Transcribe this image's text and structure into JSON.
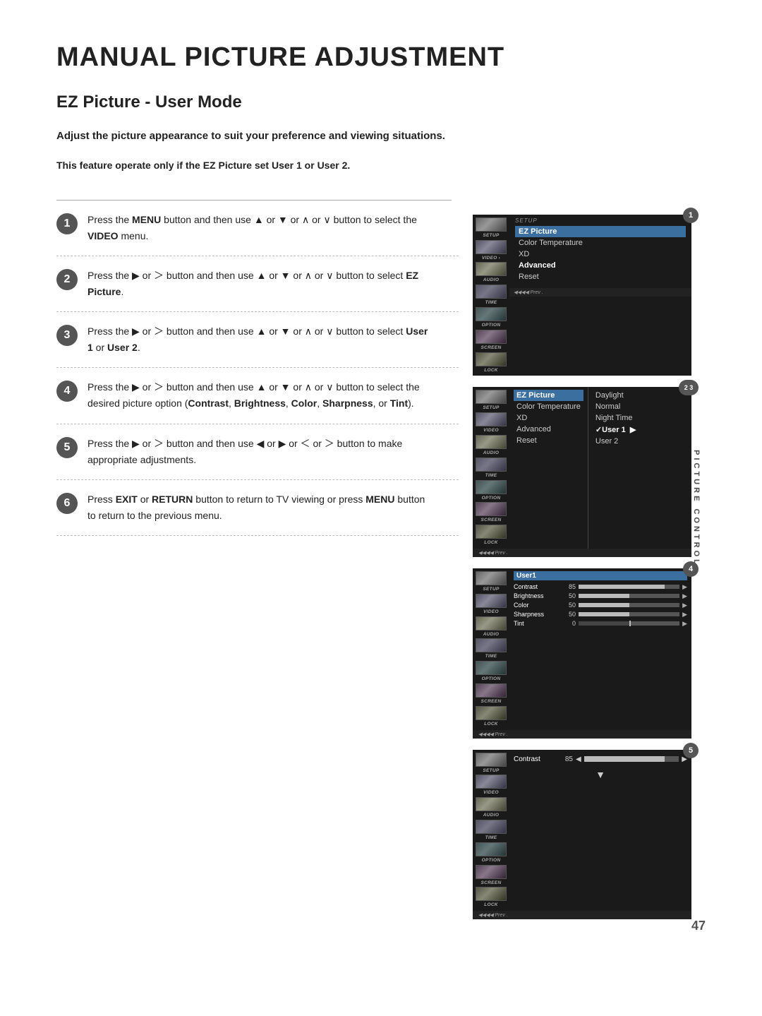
{
  "page": {
    "main_title": "MANUAL PICTURE ADJUSTMENT",
    "subtitle": "EZ Picture - User Mode",
    "intro": "Adjust the picture appearance to suit your preference and viewing situations.",
    "feature_note": "This feature operate only if the EZ Picture set User 1 or User 2.",
    "page_number": "47",
    "vertical_label": "PICTURE CONTROL"
  },
  "steps": [
    {
      "num": "1",
      "text_parts": [
        {
          "t": "Press the ",
          "b": false
        },
        {
          "t": "MENU",
          "b": true
        },
        {
          "t": " button and then use ▲ or ▼  or ∧ or ∨  button to select the ",
          "b": false
        },
        {
          "t": "VIDEO",
          "b": true
        },
        {
          "t": " menu.",
          "b": false
        }
      ]
    },
    {
      "num": "2",
      "text_parts": [
        {
          "t": "Press the ▶ or ＞ button and then use ▲ or ▼  or ∧ or ∨  button to select ",
          "b": false
        },
        {
          "t": "EZ Picture",
          "b": true
        },
        {
          "t": ".",
          "b": false
        }
      ]
    },
    {
      "num": "3",
      "text_parts": [
        {
          "t": "Press the ▶ or ＞ button and then use ▲ or ▼  or ∧ or ∨  button to select ",
          "b": false
        },
        {
          "t": "User 1",
          "b": true
        },
        {
          "t": " or ",
          "b": false
        },
        {
          "t": "User 2",
          "b": true
        },
        {
          "t": ".",
          "b": false
        }
      ]
    },
    {
      "num": "4",
      "text_parts": [
        {
          "t": "Press the ▶ or ＞ button and then use ▲ or ▼  or ∧ or ∨  button to select the desired picture option (",
          "b": false
        },
        {
          "t": "Contrast",
          "b": true
        },
        {
          "t": ", ",
          "b": false
        },
        {
          "t": "Brightness",
          "b": true
        },
        {
          "t": ", ",
          "b": false
        },
        {
          "t": "Color",
          "b": true
        },
        {
          "t": ", ",
          "b": false
        },
        {
          "t": "Sharpness",
          "b": true
        },
        {
          "t": ", or ",
          "b": false
        },
        {
          "t": "Tint",
          "b": true
        },
        {
          "t": ").",
          "b": false
        }
      ]
    },
    {
      "num": "5",
      "text_parts": [
        {
          "t": "Press the ▶ or ＞ button and then use ◀ or ▶ or ＜ or ＞ button to make appropriate adjustments.",
          "b": false
        }
      ]
    },
    {
      "num": "6",
      "text_parts": [
        {
          "t": "Press ",
          "b": false
        },
        {
          "t": "EXIT",
          "b": true
        },
        {
          "t": " or ",
          "b": false
        },
        {
          "t": "RETURN",
          "b": true
        },
        {
          "t": " button to return to TV viewing or press ",
          "b": false
        },
        {
          "t": "MENU",
          "b": true
        },
        {
          "t": " button to return to the previous menu.",
          "b": false
        }
      ]
    }
  ],
  "screenshots": [
    {
      "badge": "1",
      "sidebar_items": [
        "SETUP",
        "VIDEO",
        "AUDIO",
        "TIME",
        "OPTION",
        "SCREEN",
        "LOCK"
      ],
      "menu_title": "SETUP",
      "menu_items": [
        {
          "label": "EZ Picture",
          "selected": true
        },
        {
          "label": "Color Temperature",
          "selected": false
        },
        {
          "label": "XD",
          "selected": false
        },
        {
          "label": "Advanced",
          "selected": false
        },
        {
          "label": "Reset",
          "selected": false
        }
      ],
      "sub_items": []
    },
    {
      "badge": "2 3",
      "sidebar_items": [
        "SETUP",
        "VIDEO",
        "AUDIO",
        "TIME",
        "OPTION",
        "SCREEN",
        "LOCK"
      ],
      "menu_title": "",
      "menu_items": [
        {
          "label": "EZ Picture",
          "selected": true
        },
        {
          "label": "Color Temperature",
          "selected": false
        },
        {
          "label": "XD",
          "selected": false
        },
        {
          "label": "Advanced",
          "selected": false
        },
        {
          "label": "Reset",
          "selected": false
        }
      ],
      "sub_items": [
        {
          "label": "Daylight",
          "selected": false
        },
        {
          "label": "Normal",
          "selected": false
        },
        {
          "label": "Night Time",
          "selected": false
        },
        {
          "label": "✓User 1",
          "selected": true
        },
        {
          "label": "User 2",
          "selected": false
        }
      ]
    },
    {
      "badge": "4",
      "type": "picture",
      "menu_title": "User1",
      "rows": [
        {
          "label": "Contrast",
          "val": 85,
          "max": 100
        },
        {
          "label": "Brightness",
          "val": 50,
          "max": 100
        },
        {
          "label": "Color",
          "val": 50,
          "max": 100
        },
        {
          "label": "Sharpness",
          "val": 50,
          "max": 100
        },
        {
          "label": "Tint",
          "val": 0,
          "max": 100,
          "special": true
        }
      ]
    },
    {
      "badge": "5",
      "type": "contrast",
      "label": "Contrast",
      "val": 85,
      "max": 100
    }
  ],
  "icons": {
    "arrow_right": "▶",
    "arrow_left": "◀",
    "arrow_up": "▲",
    "arrow_down": "▼"
  }
}
